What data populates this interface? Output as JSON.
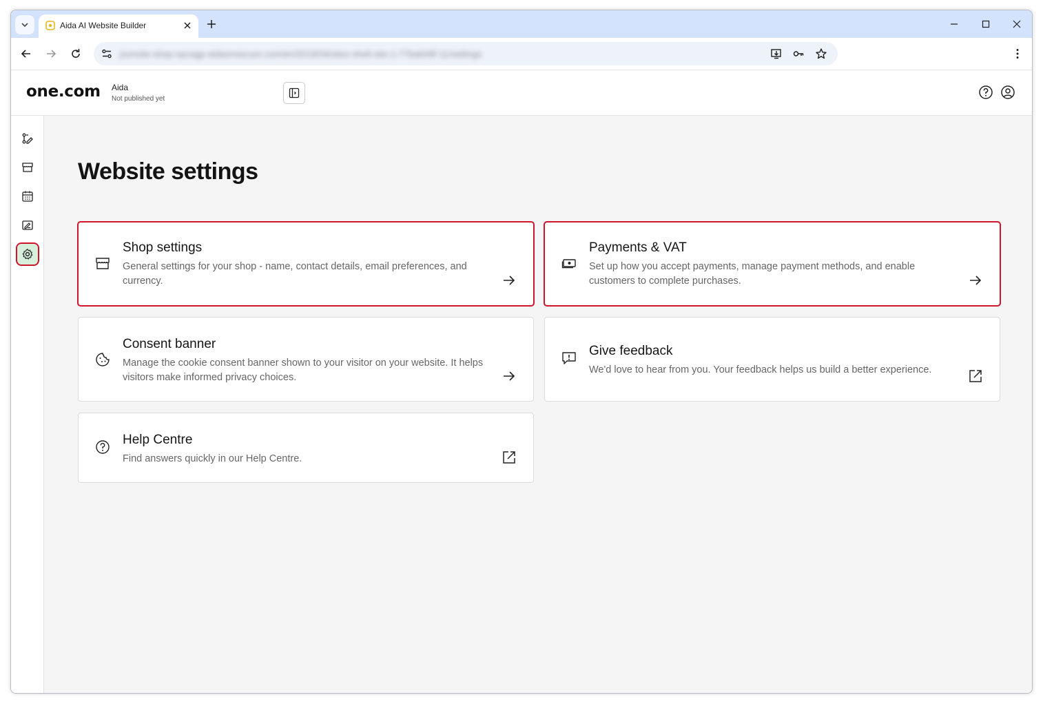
{
  "browser": {
    "tab_title": "Aida AI Website Builder",
    "url": "jsonsite-shop-opcagp-aidaonsecure.com/en/2019/04/sites-shell-site-1-77bab09f-11/settings"
  },
  "header": {
    "brand": "one.com",
    "site_name": "Aida",
    "site_status": "Not published yet"
  },
  "sidebar": {
    "items": [
      {
        "name": "edit-pages-icon"
      },
      {
        "name": "shop-icon"
      },
      {
        "name": "calendar-icon"
      },
      {
        "name": "blog-icon"
      },
      {
        "name": "settings-gear-icon",
        "active": true
      }
    ]
  },
  "main": {
    "title": "Website settings",
    "cards": [
      {
        "title": "Shop settings",
        "description": "General settings for your shop - name, contact details, email preferences, and currency.",
        "icon": "storefront-icon",
        "action": "arrow-right-icon"
      },
      {
        "title": "Payments & VAT",
        "description": "Set up how you accept payments, manage payment methods, and enable customers to complete purchases.",
        "icon": "money-icon",
        "action": "arrow-right-icon"
      },
      {
        "title": "Consent banner",
        "description": "Manage the cookie consent banner shown to your visitor on your website. It helps visitors make informed privacy choices.",
        "icon": "cookie-icon",
        "action": "arrow-right-icon"
      },
      {
        "title": "Give feedback",
        "description": "We'd love to hear from you. Your feedback helps us build a better experience.",
        "icon": "feedback-icon",
        "action": "external-link-icon"
      },
      {
        "title": "Help Centre",
        "description": "Find answers quickly in our Help Centre.",
        "icon": "help-circle-icon",
        "action": "external-link-icon"
      }
    ]
  },
  "colors": {
    "highlight": "#d0142b",
    "active_sidebar_bg": "#d7f0dc",
    "tabstrip": "#d3e3fd",
    "page_bg": "#f5f5f5"
  }
}
